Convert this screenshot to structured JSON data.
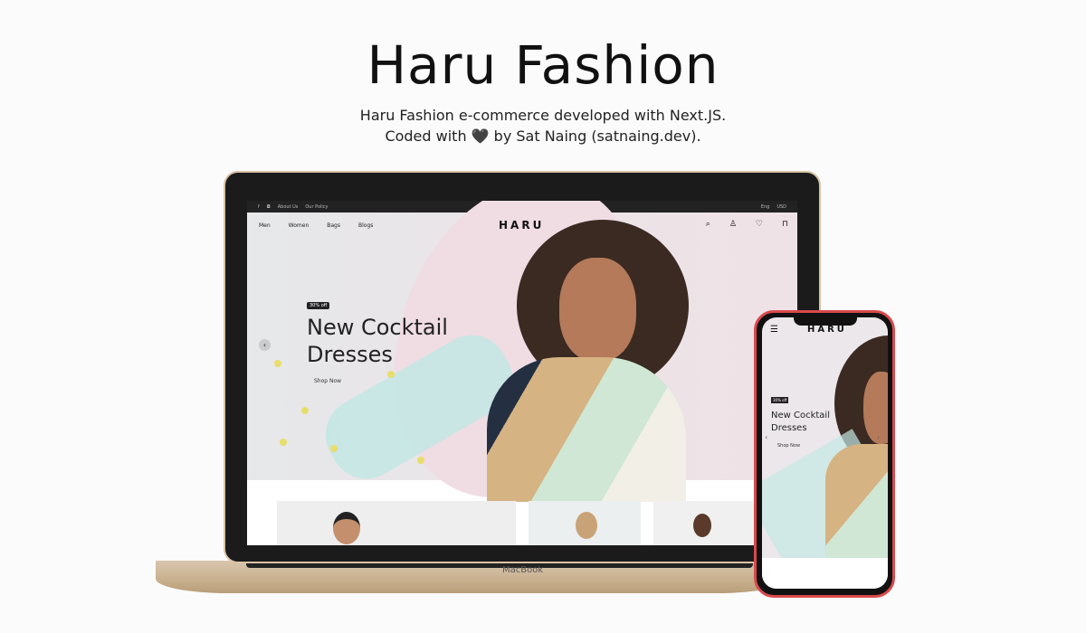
{
  "page": {
    "title": "Haru Fashion",
    "subtitle_line1": "Haru Fashion e-commerce developed with Next.JS.",
    "subtitle_line2": "Coded with 🖤 by Sat Naing (satnaing.dev)."
  },
  "laptop": {
    "brand": "MacBook",
    "topbar": {
      "links": [
        "About Us",
        "Our Policy"
      ],
      "language": "Eng",
      "currency": "USD"
    },
    "nav": {
      "items": [
        "Men",
        "Women",
        "Bags",
        "Blogs"
      ],
      "logo": "HARU"
    },
    "hero": {
      "badge": "30% off",
      "heading_line1": "New Cocktail",
      "heading_line2": "Dresses",
      "cta": "Shop Now"
    }
  },
  "phone": {
    "logo": "HARU",
    "hero": {
      "badge": "30% off",
      "heading_line1": "New Cocktail",
      "heading_line2": "Dresses",
      "cta": "Shop Now"
    }
  },
  "colors": {
    "phone_frame": "#d9494c",
    "laptop_rim": "#d9c3a5",
    "accent_dots": "#e8dd6a"
  }
}
